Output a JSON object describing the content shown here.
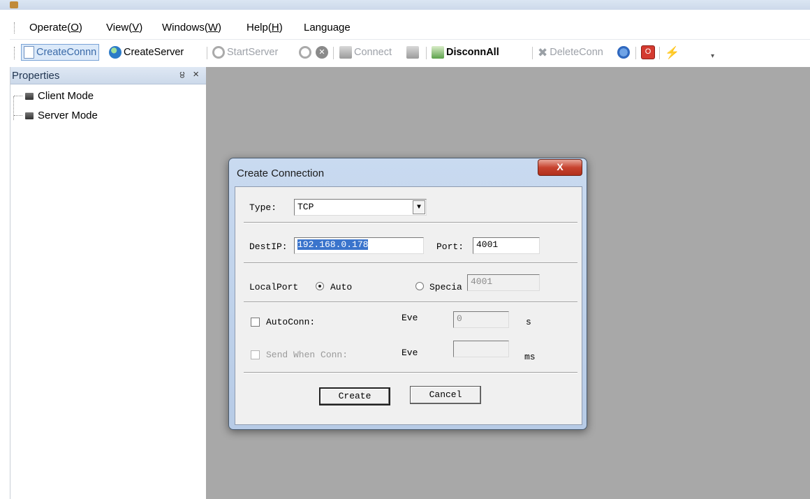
{
  "menu": {
    "operate": {
      "pre": "Operate(",
      "key": "O",
      "post": ")"
    },
    "view": {
      "pre": "View(",
      "key": "V",
      "post": ")"
    },
    "windows": {
      "pre": "Windows(",
      "key": "W",
      "post": ")"
    },
    "help": {
      "pre": "Help(",
      "key": "H",
      "post": ")"
    },
    "language": "Language"
  },
  "toolbar": {
    "create_conn": "CreateConnn",
    "create_server": "CreateServer",
    "start_server": "StartServer",
    "connect": "Connect",
    "disconn_all": "DisconnAll",
    "delete_conn": "DeleteConn"
  },
  "icons": {
    "create_conn": "new-document-icon",
    "create_server": "globe-icon",
    "start_server": "server-gear-icon",
    "stop": "stop-icon",
    "connect": "network-icon",
    "disconnect": "network-disconnect-icon",
    "disconn_all": "network-all-icon",
    "delete_conn": "delete-icon",
    "config": "config-icon",
    "power": "power-icon",
    "plug": "plug-icon"
  },
  "properties": {
    "title": "Properties",
    "pin_glyph": "੪",
    "close_glyph": "×",
    "items": [
      "Client Mode",
      "Server Mode"
    ]
  },
  "dialog": {
    "title": "Create Connection",
    "close_glyph": "X",
    "type_label": "Type:",
    "type_value": "TCP",
    "destip_label": "DestIP:",
    "destip_value": "192.168.0.178",
    "port_label": "Port:",
    "port_value": "4001",
    "localport_label": "LocalPort",
    "auto_label": "Auto",
    "special_label": "Specia",
    "special_value": "4001",
    "autoconn_label": "AutoConn:",
    "eve_label_1": "Eve",
    "eve_value_1": "0",
    "unit_1": "s",
    "send_when_conn_label": "Send When Conn:",
    "eve_label_2": "Eve",
    "eve_value_2": "",
    "unit_2": "ms",
    "create_button": "Create",
    "cancel_button": "Cancel"
  },
  "colors": {
    "workspace": "#a8a8a8",
    "dialog_frame": "#b7cbe6",
    "close_red": "#c7432f",
    "selection": "#3a74cc"
  }
}
